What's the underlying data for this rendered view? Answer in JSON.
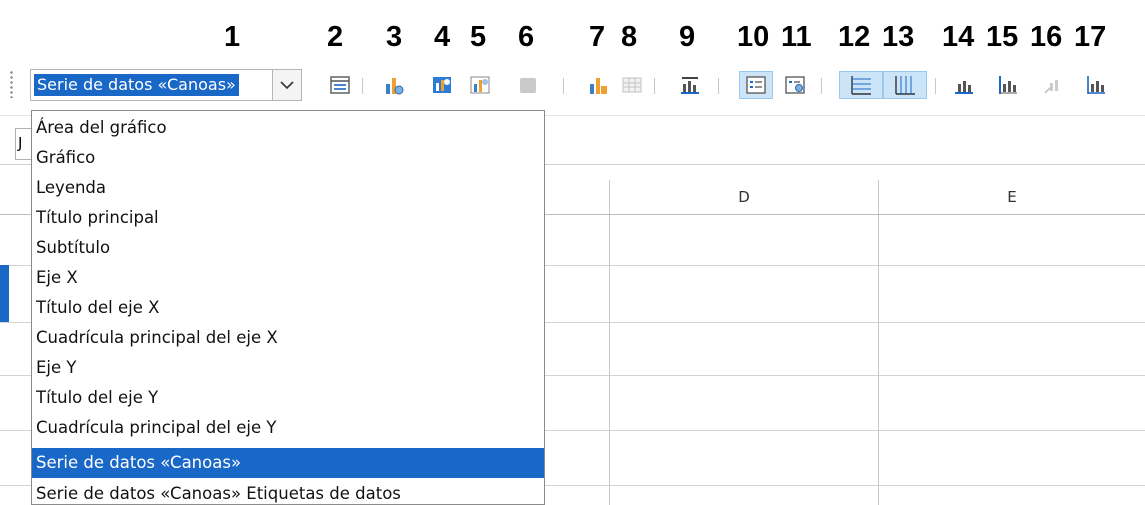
{
  "callout_numbers": [
    "1",
    "2",
    "3",
    "4",
    "5",
    "6",
    "7",
    "8",
    "9",
    "10",
    "11",
    "12",
    "13",
    "14",
    "15",
    "16",
    "17"
  ],
  "toolbar": {
    "selected_element": "Serie de datos «Canoas»",
    "icons": [
      "format-selection-icon",
      "chart-type-icon",
      "chart-area-icon",
      "chart-wall-icon",
      "chart-floor-icon",
      "data-series-icon",
      "data-table-icon",
      "titles-icon",
      "legend-on-off-icon",
      "legend-icon",
      "horizontal-grids-icon",
      "vertical-grids-icon",
      "x-axis-icon",
      "y-axis-icon",
      "z-axis-icon",
      "all-axes-icon"
    ]
  },
  "sheet": {
    "namebox_value": "J",
    "columns": [
      "D",
      "E"
    ]
  },
  "dropdown": {
    "items": [
      "Área del gráfico",
      "Gráfico",
      "Leyenda",
      "Título principal",
      "Subtítulo",
      "Eje X",
      "Título del eje X",
      "Cuadrícula principal del eje X",
      "Eje Y",
      "Título del eje Y",
      "Cuadrícula principal del eje Y",
      "Serie de datos «Canoas»",
      "Serie de datos «Canoas» Etiquetas de datos"
    ],
    "selected_index": 11
  },
  "colors": {
    "accent": "#1967c7",
    "active_bg": "#cce4f7"
  }
}
